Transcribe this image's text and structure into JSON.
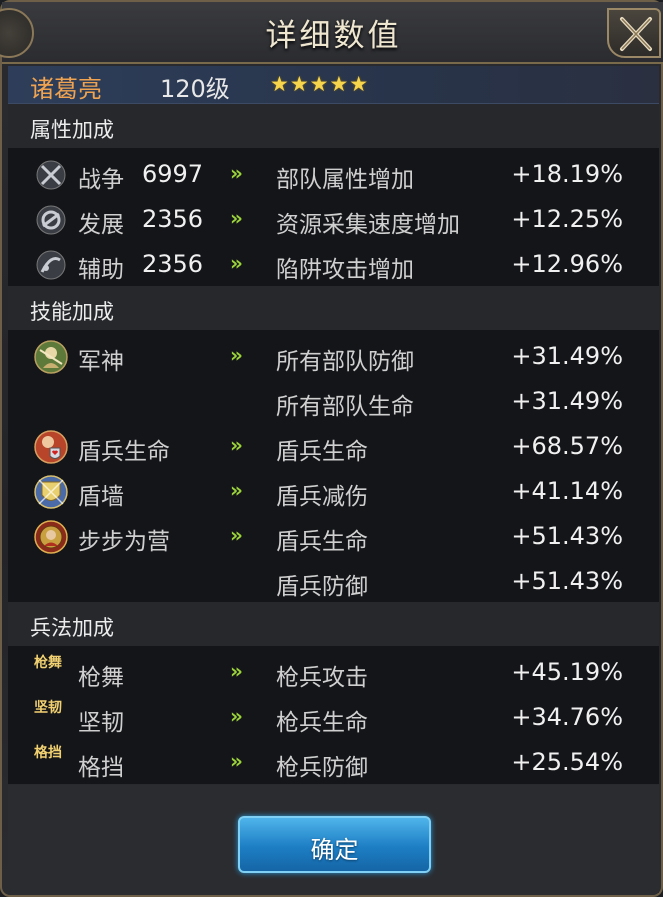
{
  "title": "详细数值",
  "hero": {
    "name": "诸葛亮",
    "level": "120级",
    "stars": "★★★★★",
    "star_count": 5
  },
  "sections": {
    "attributes": {
      "header": "属性加成",
      "rows": [
        {
          "icon": "crossed-swords-icon",
          "label": "战争",
          "number": "6997",
          "desc": "部队属性增加",
          "value": "+18.19%"
        },
        {
          "icon": "development-icon",
          "label": "发展",
          "number": "2356",
          "desc": "资源采集速度增加",
          "value": "+12.25%"
        },
        {
          "icon": "support-icon",
          "label": "辅助",
          "number": "2356",
          "desc": "陷阱攻击增加",
          "value": "+12.96%"
        }
      ]
    },
    "skills": {
      "header": "技能加成",
      "rows": [
        {
          "icon": "war-god-skill-icon",
          "label": "军神",
          "desc": "所有部队防御",
          "value": "+31.49%"
        },
        {
          "icon": "",
          "label": "",
          "desc": "所有部队生命",
          "value": "+31.49%"
        },
        {
          "icon": "shield-health-skill-icon",
          "label": "盾兵生命",
          "desc": "盾兵生命",
          "value": "+68.57%"
        },
        {
          "icon": "shield-wall-skill-icon",
          "label": "盾墙",
          "desc": "盾兵减伤",
          "value": "+41.14%"
        },
        {
          "icon": "step-by-step-skill-icon",
          "label": "步步为营",
          "desc": "盾兵生命",
          "value": "+51.43%"
        },
        {
          "icon": "",
          "label": "",
          "desc": "盾兵防御",
          "value": "+51.43%"
        }
      ]
    },
    "tactics": {
      "header": "兵法加成",
      "rows": [
        {
          "icon": "spear-dance-icon",
          "icon_text": "枪舞",
          "label": "枪舞",
          "desc": "枪兵攻击",
          "value": "+45.19%"
        },
        {
          "icon": "tenacity-icon",
          "icon_text": "坚韧",
          "label": "坚韧",
          "desc": "枪兵生命",
          "value": "+34.76%"
        },
        {
          "icon": "parry-icon",
          "icon_text": "格挡",
          "label": "格挡",
          "desc": "枪兵防御",
          "value": "+25.54%"
        }
      ]
    }
  },
  "arrow_glyph": "»",
  "confirm_label": "确定",
  "colors": {
    "hero_name": "#f0a451",
    "star": "#f6d44c",
    "arrow": "#9bd33a",
    "confirm": "#1d7ec4",
    "frame": "#6e6048"
  }
}
